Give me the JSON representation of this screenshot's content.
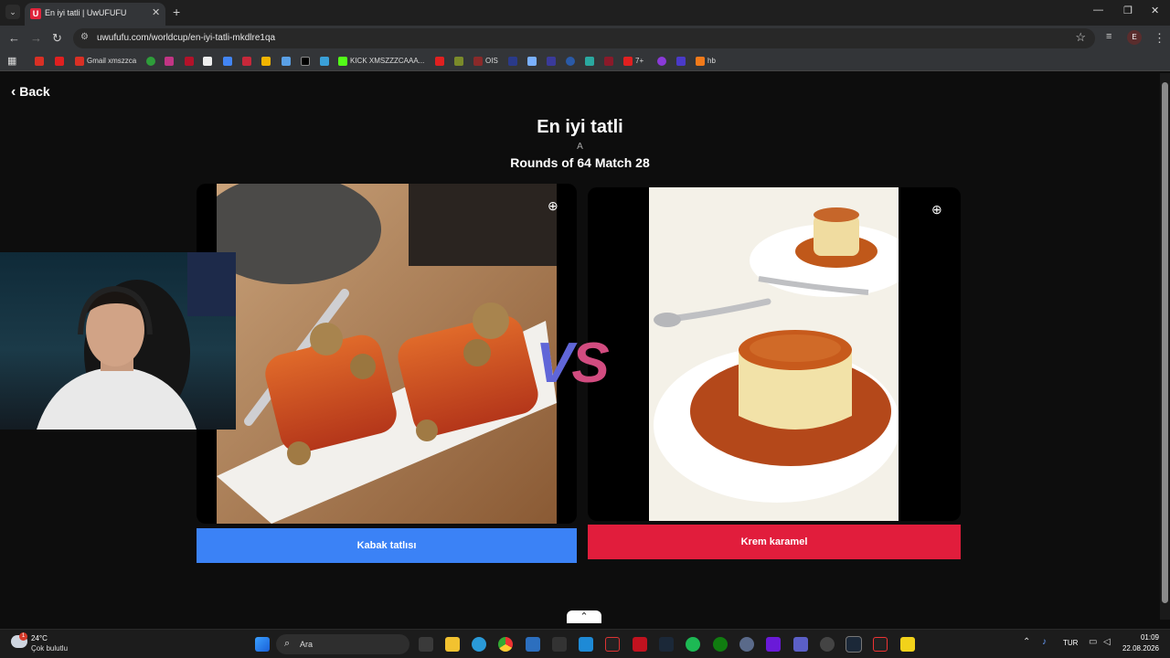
{
  "browser": {
    "tab_title": "En iyi tatli | UwUFUFU",
    "tab_favicon": "U",
    "url": "uwufufu.com/worldcup/en-iyi-tatli-mkdlre1qa",
    "profile_letter": "E",
    "bookmarks": [
      "Gmail xmszzca",
      "KICK XMSZZZCAAA...",
      "OIS",
      "7+",
      "hb"
    ]
  },
  "page": {
    "back_label": "Back",
    "title": "En iyi tatli",
    "subtitle": "A",
    "round_label": "Rounds of 64 Match 28",
    "vs_v": "V",
    "vs_s": "S",
    "left_choice": {
      "label": "Kabak tatlısı",
      "color": "#3b82f6"
    },
    "right_choice": {
      "label": "Krem karamel",
      "color": "#e11d3c"
    }
  },
  "taskbar": {
    "weather_temp": "24°C",
    "weather_desc": "Çok bulutlu",
    "search_placeholder": "Ara",
    "lang": "TUR",
    "time": "01:09",
    "date": "22.08.2026",
    "notif_count": "1"
  }
}
